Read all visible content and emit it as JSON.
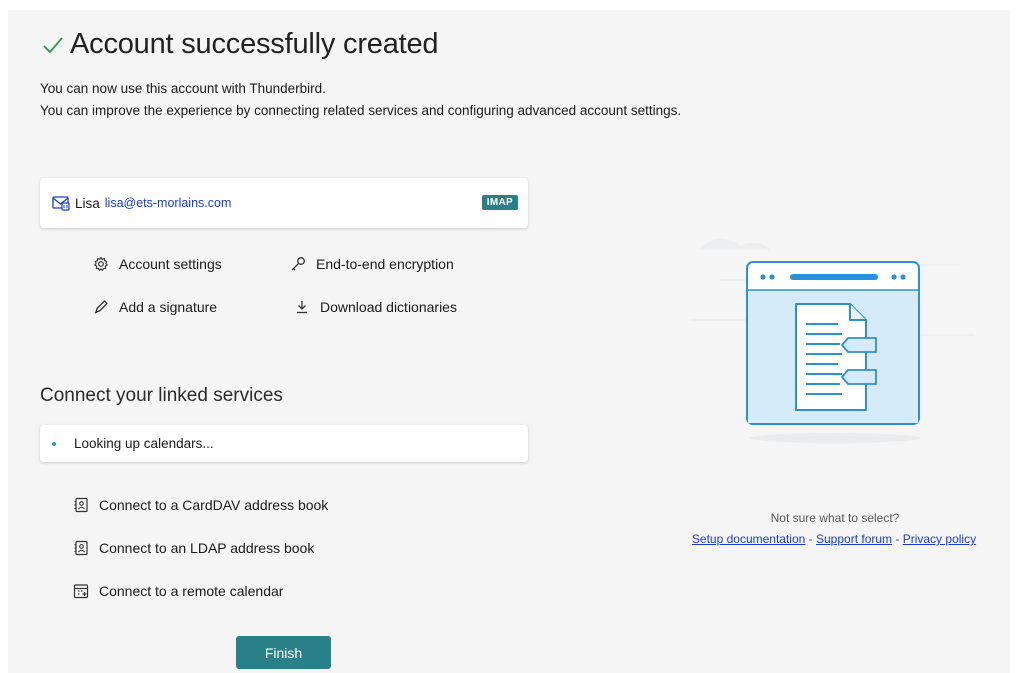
{
  "header": {
    "title": "Account successfully created",
    "subtitle_1": "You can now use this account with Thunderbird.",
    "subtitle_2": "You can improve the experience by connecting related services and configuring advanced account settings."
  },
  "account": {
    "name": "Lisa",
    "email": "lisa@ets-morlains.com",
    "type_badge": "IMAP"
  },
  "actions": {
    "account_settings": "Account settings",
    "encryption": "End-to-end encryption",
    "signature": "Add a signature",
    "dictionaries": "Download dictionaries"
  },
  "linked_services": {
    "title": "Connect your linked services",
    "status": "Looking up calendars...",
    "items": [
      {
        "label": "Connect to a CardDAV address book",
        "icon": "address-book-icon"
      },
      {
        "label": "Connect to an LDAP address book",
        "icon": "address-book-icon"
      },
      {
        "label": "Connect to a remote calendar",
        "icon": "calendar-icon"
      }
    ]
  },
  "footer": {
    "finish_label": "Finish"
  },
  "help": {
    "prompt": "Not sure what to select?",
    "setup_docs": "Setup documentation",
    "support_forum": "Support forum",
    "privacy_policy": "Privacy policy",
    "separator": " - "
  },
  "colors": {
    "accent": "#2a8088",
    "link": "#1a3bd6",
    "check": "#2e9a4c"
  }
}
